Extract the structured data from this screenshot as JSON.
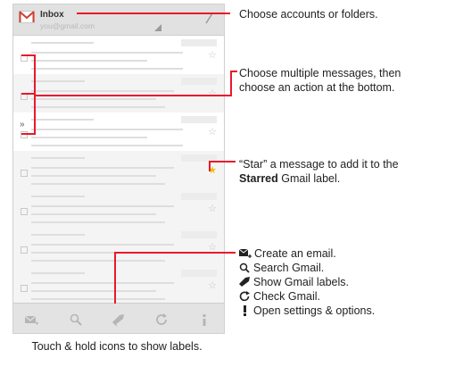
{
  "header": {
    "title": "Inbox",
    "account": "you@gmail.com"
  },
  "messages": [
    {
      "state": "unread",
      "starred": false
    },
    {
      "state": "read",
      "starred": false
    },
    {
      "state": "unread",
      "starred": false
    },
    {
      "state": "read",
      "starred": true
    },
    {
      "state": "read",
      "starred": false
    },
    {
      "state": "read",
      "starred": false
    },
    {
      "state": "read",
      "starred": false
    }
  ],
  "bottom_bar": [
    "compose-icon",
    "search-icon",
    "label-icon",
    "refresh-icon",
    "menu-icon"
  ],
  "callouts": {
    "accounts": "Choose accounts or folders.",
    "multi_line1": "Choose multiple messages, then",
    "multi_line2": "choose an action at the bottom.",
    "star_line1": "“Star” a message to add it to the",
    "star_bold": "Starred",
    "star_rest": " Gmail label."
  },
  "legend": {
    "compose": "Create an email.",
    "search": "Search Gmail.",
    "labels": "Show Gmail labels.",
    "check": "Check Gmail.",
    "settings": "Open settings & options."
  },
  "caption": "Touch & hold icons to show labels.",
  "colors": {
    "callout_line": "#e8192c",
    "star_on": "#f0c000",
    "gmail_red": "#d23f31"
  }
}
